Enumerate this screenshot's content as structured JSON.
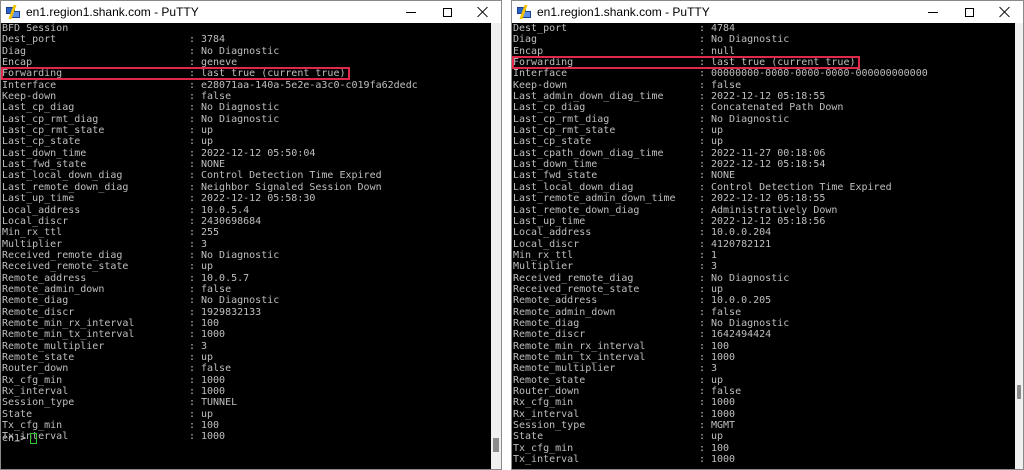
{
  "windows": [
    {
      "title": "en1.region1.shank.com - PuTTY",
      "header": "BFD Session",
      "highlight_index": 3,
      "rows": [
        {
          "key": "Dest_port",
          "value": "3784"
        },
        {
          "key": "Diag",
          "value": "No Diagnostic"
        },
        {
          "key": "Encap",
          "value": "geneve"
        },
        {
          "key": "Forwarding",
          "value": "last true (current true)"
        },
        {
          "key": "Interface",
          "value": "e28071aa-140a-5e2e-a3c0-c019fa62dedc"
        },
        {
          "key": "Keep-down",
          "value": "false"
        },
        {
          "key": "Last_cp_diag",
          "value": "No Diagnostic"
        },
        {
          "key": "Last_cp_rmt_diag",
          "value": "No Diagnostic"
        },
        {
          "key": "Last_cp_rmt_state",
          "value": "up"
        },
        {
          "key": "Last_cp_state",
          "value": "up"
        },
        {
          "key": "Last_down_time",
          "value": "2022-12-12 05:50:04"
        },
        {
          "key": "Last_fwd_state",
          "value": "NONE"
        },
        {
          "key": "Last_local_down_diag",
          "value": "Control Detection Time Expired"
        },
        {
          "key": "Last_remote_down_diag",
          "value": "Neighbor Signaled Session Down"
        },
        {
          "key": "Last_up_time",
          "value": "2022-12-12 05:58:30"
        },
        {
          "key": "Local_address",
          "value": "10.0.5.4"
        },
        {
          "key": "Local_discr",
          "value": "2430698684"
        },
        {
          "key": "Min_rx_ttl",
          "value": "255"
        },
        {
          "key": "Multiplier",
          "value": "3"
        },
        {
          "key": "Received_remote_diag",
          "value": "No Diagnostic"
        },
        {
          "key": "Received_remote_state",
          "value": "up"
        },
        {
          "key": "Remote_address",
          "value": "10.0.5.7"
        },
        {
          "key": "Remote_admin_down",
          "value": "false"
        },
        {
          "key": "Remote_diag",
          "value": "No Diagnostic"
        },
        {
          "key": "Remote_discr",
          "value": "1929832133"
        },
        {
          "key": "Remote_min_rx_interval",
          "value": "100"
        },
        {
          "key": "Remote_min_tx_interval",
          "value": "1000"
        },
        {
          "key": "Remote_multiplier",
          "value": "3"
        },
        {
          "key": "Remote_state",
          "value": "up"
        },
        {
          "key": "Router_down",
          "value": "false"
        },
        {
          "key": "Rx_cfg_min",
          "value": "1000"
        },
        {
          "key": "Rx_interval",
          "value": "1000"
        },
        {
          "key": "Session_type",
          "value": "TUNNEL"
        },
        {
          "key": "State",
          "value": "up"
        },
        {
          "key": "Tx_cfg_min",
          "value": "100"
        },
        {
          "key": "Tx_interval",
          "value": "1000"
        }
      ],
      "prompt": "en1>"
    },
    {
      "title": "en1.region1.shank.com - PuTTY",
      "highlight_index": 3,
      "rows": [
        {
          "key": "Dest_port",
          "value": "4784"
        },
        {
          "key": "Diag",
          "value": "No Diagnostic"
        },
        {
          "key": "Encap",
          "value": "null"
        },
        {
          "key": "Forwarding",
          "value": "last true (current true)"
        },
        {
          "key": "Interface",
          "value": "00000000-0000-0000-0000-000000000000"
        },
        {
          "key": "Keep-down",
          "value": "false"
        },
        {
          "key": "Last_admin_down_diag_time",
          "value": "2022-12-12 05:18:55"
        },
        {
          "key": "Last_cp_diag",
          "value": "Concatenated Path Down"
        },
        {
          "key": "Last_cp_rmt_diag",
          "value": "No Diagnostic"
        },
        {
          "key": "Last_cp_rmt_state",
          "value": "up"
        },
        {
          "key": "Last_cp_state",
          "value": "up"
        },
        {
          "key": "Last_cpath_down_diag_time",
          "value": "2022-11-27 00:18:06"
        },
        {
          "key": "Last_down_time",
          "value": "2022-12-12 05:18:54"
        },
        {
          "key": "Last_fwd_state",
          "value": "NONE"
        },
        {
          "key": "Last_local_down_diag",
          "value": "Control Detection Time Expired"
        },
        {
          "key": "Last_remote_admin_down_time",
          "value": "2022-12-12 05:18:55"
        },
        {
          "key": "Last_remote_down_diag",
          "value": "Administratively Down"
        },
        {
          "key": "Last_up_time",
          "value": "2022-12-12 05:18:56"
        },
        {
          "key": "Local_address",
          "value": "10.0.0.204"
        },
        {
          "key": "Local_discr",
          "value": "4120782121"
        },
        {
          "key": "Min_rx_ttl",
          "value": "1"
        },
        {
          "key": "Multiplier",
          "value": "3"
        },
        {
          "key": "Received_remote_diag",
          "value": "No Diagnostic"
        },
        {
          "key": "Received_remote_state",
          "value": "up"
        },
        {
          "key": "Remote_address",
          "value": "10.0.0.205"
        },
        {
          "key": "Remote_admin_down",
          "value": "false"
        },
        {
          "key": "Remote_diag",
          "value": "No Diagnostic"
        },
        {
          "key": "Remote_discr",
          "value": "1642494424"
        },
        {
          "key": "Remote_min_rx_interval",
          "value": "100"
        },
        {
          "key": "Remote_min_tx_interval",
          "value": "1000"
        },
        {
          "key": "Remote_multiplier",
          "value": "3"
        },
        {
          "key": "Remote_state",
          "value": "up"
        },
        {
          "key": "Router_down",
          "value": "false"
        },
        {
          "key": "Rx_cfg_min",
          "value": "1000"
        },
        {
          "key": "Rx_interval",
          "value": "1000"
        },
        {
          "key": "Session_type",
          "value": "MGMT"
        },
        {
          "key": "State",
          "value": "up"
        },
        {
          "key": "Tx_cfg_min",
          "value": "100"
        },
        {
          "key": "Tx_interval",
          "value": "1000"
        }
      ]
    }
  ],
  "colors": {
    "terminal_bg": "#000000",
    "terminal_text": "#bfbfbf",
    "highlight_border": "#e0284a",
    "cursor": "#2ec52e"
  },
  "icons": {
    "app": "putty-icon",
    "minimize": "minimize-icon",
    "maximize": "maximize-icon",
    "close": "close-icon"
  }
}
